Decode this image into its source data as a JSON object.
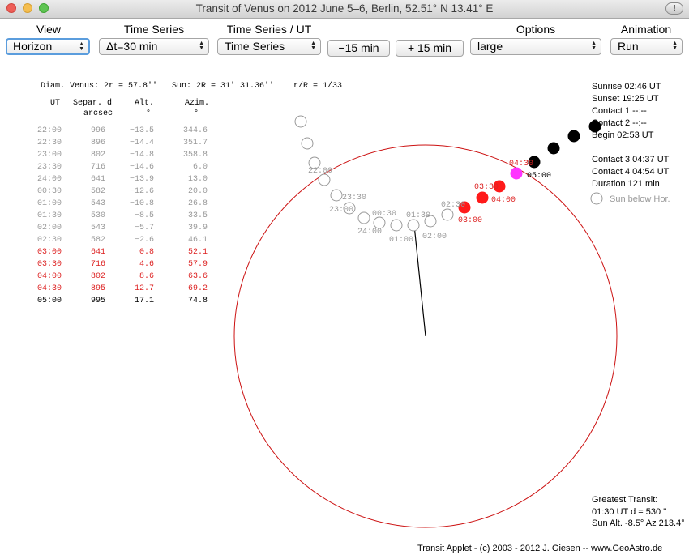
{
  "window": {
    "title": "Transit of Venus on 2012 June 5–6, Berlin, 52.51° N  13.41° E",
    "alert_icon": "!"
  },
  "toolbar": {
    "view": {
      "label": "View",
      "value": "Horizon"
    },
    "time_series": {
      "label": "Time Series",
      "value": "Δt=30 min"
    },
    "time_series_ut": {
      "label": "Time Series / UT",
      "value": "Time Series"
    },
    "minus_button": "−15 min",
    "plus_button": "+ 15 min",
    "options": {
      "label": "Options",
      "value": "large"
    },
    "animation": {
      "label": "Animation",
      "value": "Run"
    }
  },
  "diameters": {
    "venus": "Diam. Venus: 2r = 57.8''",
    "sun": "Sun: 2R = 31' 31.36''",
    "ratio": "r/R = 1/33"
  },
  "table": {
    "headers": {
      "ut": "UT",
      "sep": "Separ. d",
      "sep_unit": "arcsec",
      "alt": "Alt.",
      "alt_unit": "°",
      "azim": "Azim.",
      "azim_unit": "°"
    },
    "rows": [
      {
        "ut": "22:00",
        "sep": "996",
        "alt": "−13.5",
        "azim": "344.6",
        "state": "below"
      },
      {
        "ut": "22:30",
        "sep": "896",
        "alt": "−14.4",
        "azim": "351.7",
        "state": "below"
      },
      {
        "ut": "23:00",
        "sep": "802",
        "alt": "−14.8",
        "azim": "358.8",
        "state": "below"
      },
      {
        "ut": "23:30",
        "sep": "716",
        "alt": "−14.6",
        "azim": "6.0",
        "state": "below"
      },
      {
        "ut": "24:00",
        "sep": "641",
        "alt": "−13.9",
        "azim": "13.0",
        "state": "below"
      },
      {
        "ut": "00:30",
        "sep": "582",
        "alt": "−12.6",
        "azim": "20.0",
        "state": "below"
      },
      {
        "ut": "01:00",
        "sep": "543",
        "alt": "−10.8",
        "azim": "26.8",
        "state": "below"
      },
      {
        "ut": "01:30",
        "sep": "530",
        "alt": "−8.5",
        "azim": "33.5",
        "state": "below"
      },
      {
        "ut": "02:00",
        "sep": "543",
        "alt": "−5.7",
        "azim": "39.9",
        "state": "below"
      },
      {
        "ut": "02:30",
        "sep": "582",
        "alt": "−2.6",
        "azim": "46.1",
        "state": "below"
      },
      {
        "ut": "03:00",
        "sep": "641",
        "alt": "0.8",
        "azim": "52.1",
        "state": "visible"
      },
      {
        "ut": "03:30",
        "sep": "716",
        "alt": "4.6",
        "azim": "57.9",
        "state": "visible"
      },
      {
        "ut": "04:00",
        "sep": "802",
        "alt": "8.6",
        "azim": "63.6",
        "state": "visible"
      },
      {
        "ut": "04:30",
        "sep": "895",
        "alt": "12.7",
        "azim": "69.2",
        "state": "visible"
      },
      {
        "ut": "05:00",
        "sep": "995",
        "alt": "17.1",
        "azim": "74.8",
        "state": "after"
      }
    ]
  },
  "info": {
    "sunrise": "Sunrise  02:46 UT",
    "sunset": "Sunset  19:25 UT",
    "contact1": "Contact 1      --:--",
    "contact2": "Contact 2      --:--",
    "begin": "Begin      02:53 UT",
    "contact3": "Contact 3    04:37 UT",
    "contact4": "Contact 4    04:54 UT",
    "duration": "Duration   121 min",
    "legend_below": "Sun below Hor."
  },
  "greatest": {
    "title": "Greatest Transit:",
    "line1": " 01:30 UT   d = 530 ''",
    "line2": "Sun Alt. -8.5°  Az 213.4°"
  },
  "footer": "Transit Applet  -  (c) 2003 - 2012  J. Giesen  --  www.GeoAstro.de",
  "plot_labels": {
    "l2200": "22:00",
    "l2330": "23:30",
    "l2300": "23:00",
    "l0030": "00:30",
    "l2400": "24:00",
    "l0130": "01:30",
    "l0100": "01:00",
    "l0200": "02:00",
    "l0230": "02:30",
    "l0330": "03:30",
    "l0300": "03:00",
    "l0400": "04:00",
    "l0430": "04:30",
    "l0500": "05:00"
  },
  "colors": {
    "sun_disk": "#cc1111",
    "visible": "#ff1a1a",
    "current": "#ff33ff",
    "after": "#000000",
    "below": "#999999"
  }
}
